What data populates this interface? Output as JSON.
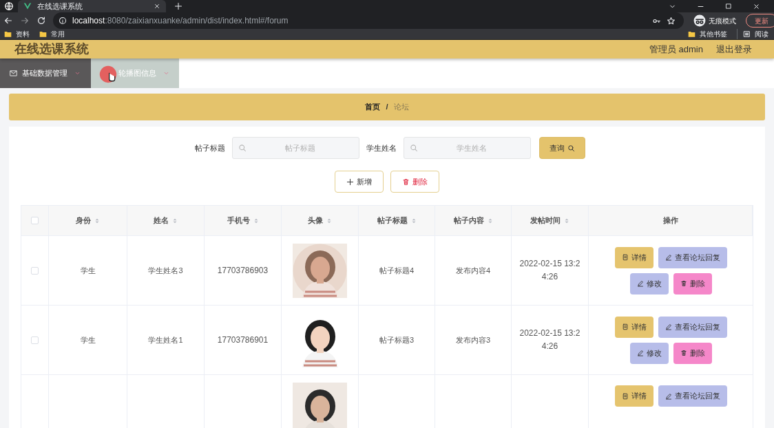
{
  "browser": {
    "tab_title": "在线选课系统",
    "url_host": "localhost",
    "url_path": ":8080/zaixianxuanke/admin/dist/index.html#/forum",
    "incognito_label": "无痕模式",
    "update_button": "更新",
    "bookmarks": [
      "资料",
      "常用"
    ],
    "bookmarks_right": [
      {
        "kind": "folder",
        "label": "其他书签"
      },
      {
        "kind": "list",
        "label": "阅读"
      }
    ]
  },
  "header": {
    "title": "在线选课系统",
    "user": "管理员 admin",
    "logout": "退出登录"
  },
  "menu": [
    {
      "label": "基础数据管理",
      "hovered": false
    },
    {
      "label": "轮播图信息",
      "hovered": true
    }
  ],
  "breadcrumb": {
    "items": [
      "首页",
      "论坛"
    ],
    "separator": "/"
  },
  "search": {
    "fields": [
      {
        "label": "帖子标题",
        "placeholder": "帖子标题"
      },
      {
        "label": "学生姓名",
        "placeholder": "学生姓名"
      }
    ],
    "button": "查询"
  },
  "actions": [
    {
      "kind": "add",
      "label": "新增"
    },
    {
      "kind": "delete",
      "label": "删除"
    }
  ],
  "table": {
    "select_all_checked": false,
    "columns": [
      {
        "label": "身份",
        "sortable": true
      },
      {
        "label": "姓名",
        "sortable": true
      },
      {
        "label": "手机号",
        "sortable": true
      },
      {
        "label": "头像",
        "sortable": true
      },
      {
        "label": "帖子标题",
        "sortable": true
      },
      {
        "label": "帖子内容",
        "sortable": true
      },
      {
        "label": "发帖时间",
        "sortable": true
      },
      {
        "label": "操作",
        "sortable": false
      }
    ],
    "rows": [
      {
        "checked": false,
        "identity": "学生",
        "name": "学生姓名3",
        "phone": "17703786903",
        "avatar": {
          "kind": "picture"
        },
        "title": "帖子标题4",
        "content": "发布内容4",
        "time": "2022-02-15 13:24:26",
        "buttons": [
          {
            "kind": "detail",
            "label": "详情"
          },
          {
            "kind": "replies",
            "label": "查看论坛回复"
          },
          {
            "kind": "edit",
            "label": "修改"
          },
          {
            "kind": "delete",
            "label": "删除"
          }
        ]
      },
      {
        "checked": false,
        "identity": "学生",
        "name": "学生姓名1",
        "phone": "17703786901",
        "avatar": {
          "kind": "picture"
        },
        "title": "帖子标题3",
        "content": "发布内容3",
        "time": "2022-02-15 13:24:26",
        "buttons": [
          {
            "kind": "detail",
            "label": "详情"
          },
          {
            "kind": "replies",
            "label": "查看论坛回复"
          },
          {
            "kind": "edit",
            "label": "修改"
          },
          {
            "kind": "delete",
            "label": "删除"
          }
        ]
      },
      {
        "avatar": {
          "kind": "picture"
        },
        "buttons": [
          {
            "kind": "detail",
            "label": "详情"
          },
          {
            "kind": "replies",
            "label": "查看论坛回复"
          }
        ]
      }
    ]
  }
}
